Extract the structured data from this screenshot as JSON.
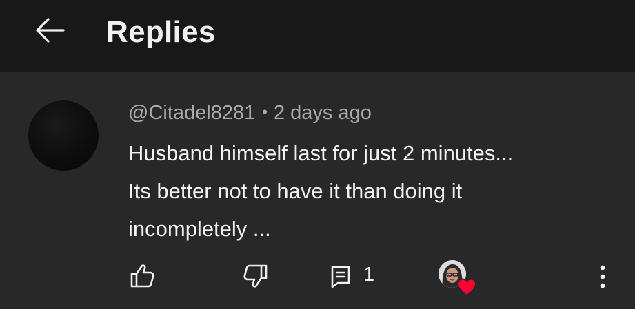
{
  "header": {
    "title": "Replies",
    "back_icon": "arrow-left-icon"
  },
  "comment": {
    "author": "@Citadel8281",
    "separator": "•",
    "time": "2 days ago",
    "lines": [
      "Husband himself last for just 2 minutes...",
      "Its better not to have it than doing it",
      "incompletely ..."
    ],
    "reply_count": "1",
    "hearted_by_creator": true
  },
  "actions": {
    "like_icon": "thumb-up-icon",
    "dislike_icon": "thumb-down-icon",
    "reply_icon": "reply-comment-icon",
    "heart_icon": "heart-icon",
    "more_icon": "more-vert-icon"
  },
  "colors": {
    "background": "#282828",
    "header_bg": "#181818",
    "primary_text": "#f1f1f1",
    "secondary_text": "#aaaaaa",
    "heart_red": "#ff0033"
  }
}
